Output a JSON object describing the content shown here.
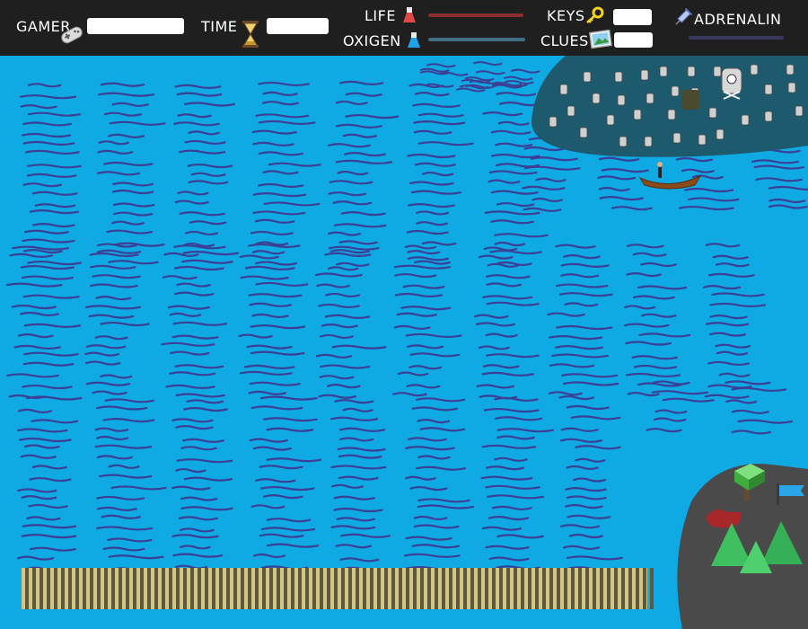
{
  "hud": {
    "gamer_label": "GAMER",
    "gamer_value": "",
    "time_label": "TIME",
    "time_value": "",
    "life_label": "LIFE",
    "oxigen_label": "OXIGEN",
    "keys_label": "KEYS",
    "keys_value": "",
    "clues_label": "CLUES",
    "clues_value": "",
    "adrenalin_label": "ADRENALIN"
  },
  "colors": {
    "hud_bg": "#1f1f1f",
    "water": "#0fa9e3",
    "wave": "#3b3f96",
    "island": "#1e5a6e",
    "rock": "#4a4a4a",
    "life_bar": "#8a2e2e",
    "oxigen_bar": "#3f6f82",
    "adrenalin_bar": "#3b3860"
  },
  "icons": {
    "gamer": "gamepad-icon",
    "time": "hourglass-icon",
    "life": "flask-red-icon",
    "oxigen": "flask-blue-icon",
    "keys": "key-icon",
    "clues": "picture-icon",
    "adrenalin": "syringe-icon"
  }
}
